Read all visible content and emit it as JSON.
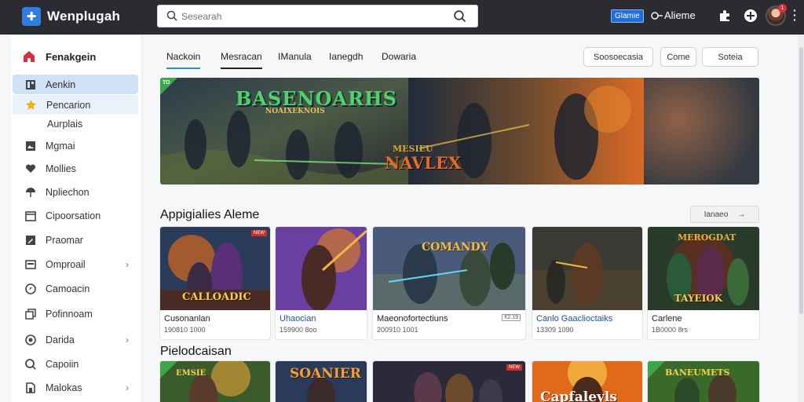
{
  "app": {
    "title": "Wenplugah",
    "logo_icon": "app-logo-icon"
  },
  "search": {
    "placeholder": "Sesearah"
  },
  "header": {
    "badge": "Glamie",
    "user_name": "Alieme",
    "notification_count": "1"
  },
  "sidebar": {
    "home_label": "Fenakgein",
    "items": [
      {
        "label": "Aenkin",
        "icon": "grid-icon"
      },
      {
        "label": "Pencarion",
        "icon": "star-icon"
      },
      {
        "label": "Aurplais",
        "icon": ""
      },
      {
        "label": "Mgmai",
        "icon": "image-icon"
      },
      {
        "label": "Mollies",
        "icon": "heart-icon"
      },
      {
        "label": "Npliechon",
        "icon": "umbrella-icon"
      },
      {
        "label": "Cipoorsation",
        "icon": "calendar-icon"
      },
      {
        "label": "Praomar",
        "icon": "edit-icon"
      },
      {
        "label": "Omproail",
        "icon": "window-icon",
        "chevron": "›"
      },
      {
        "label": "Camoacin",
        "icon": "compass-icon"
      },
      {
        "label": "Pofinnoam",
        "icon": "copy-icon"
      },
      {
        "label": "Darida",
        "icon": "target-icon",
        "chevron": "›"
      },
      {
        "label": "Capoiin",
        "icon": "search-circle-icon"
      },
      {
        "label": "Malokas",
        "icon": "book-icon",
        "chevron": "›"
      }
    ]
  },
  "tabs": [
    "Nackoin",
    "Mesracan",
    "IManula",
    "Ianegdh",
    "Dowaria"
  ],
  "actions": [
    "Soosoecasia",
    "Come",
    "Soteia"
  ],
  "hero": {
    "title_line1": "BASENOARHS",
    "subtitle": "NOAIXEKNOIS",
    "badge": "TO",
    "center_line1": "MESIEU",
    "center_line2": "NAVLEX"
  },
  "sections": [
    {
      "title": "Appigialies Aleme",
      "see_more": "Ianaeo"
    },
    {
      "title": "Pielodcaisan"
    }
  ],
  "cards": [
    {
      "title": "Cusonanlan",
      "meta": "190810 1000",
      "tag": "NEW",
      "art": "CALLOADIC"
    },
    {
      "title": "Uhaocian",
      "meta": "159900 8oo",
      "art": ""
    },
    {
      "title": "Maeonofortectiuns",
      "meta": "200910 1001",
      "price": "€2.19",
      "art": "COMANDY"
    },
    {
      "title": "Canlo Gaaclioctaiks",
      "meta": "13309 1090",
      "art": ""
    },
    {
      "title": "Carlene",
      "meta": "1B0000 8rs",
      "art_top": "MEROGDAT",
      "art": "TAYEIOK"
    }
  ],
  "cards_row2": [
    {
      "art": "EMSIE"
    },
    {
      "art": "SOANIER"
    },
    {
      "tag": "NEW",
      "art": ""
    },
    {
      "art": "Capfaleyls"
    },
    {
      "art": "BANEUMETS"
    }
  ]
}
